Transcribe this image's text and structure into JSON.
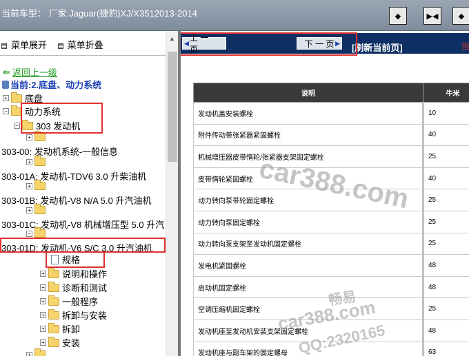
{
  "topbar": {
    "title": "当前车型： 厂家:Jaguar(捷豹)XJ/X3512013-2014"
  },
  "left": {
    "expand_label": "菜单展开",
    "collapse_label": "菜单折叠",
    "back_label": "返回上一级",
    "current_label": "当前:2.底盘、动力系统",
    "tree": {
      "chassis": "底盘",
      "powertrain": "动力系统",
      "engine303": "303 发动机",
      "general": "303-00: 发动机系统-一般信息",
      "tdv6": "303-01A: 发动机-TDV6 3.0 升柴油机",
      "v8na": "303-01B: 发动机-V8 N/A 5.0 升汽油机",
      "v8sc": "303-01C: 发动机-V8 机械增压型 5.0 升汽",
      "v6sc": "303-01D: 发动机-V6 S/C 3.0 升汽油机",
      "spec": "规格",
      "desc": "说明和操作",
      "diag": "诊断和测试",
      "proc": "一般程序",
      "remove_install": "拆卸与安装",
      "remove": "拆卸",
      "install": "安装"
    }
  },
  "right": {
    "prev_label": "上 一 页",
    "next_label": "下 一 页",
    "refresh_label": "[刷新当前页]",
    "red_char": "当",
    "table": {
      "headers": [
        "说明",
        "牛米"
      ],
      "rows": [
        [
          "发动机盖安装螺栓",
          "10"
        ],
        [
          "附件传动带张紧器紧固螺栓",
          "40"
        ],
        [
          "机械增压器皮带惰轮/张紧器支架固定螺栓",
          "25"
        ],
        [
          "皮带惰轮紧固螺栓",
          "40"
        ],
        [
          "动力转向泵带轮固定螺栓",
          "25"
        ],
        [
          "动力转向泵固定螺栓",
          "25"
        ],
        [
          "动力转向泵支架至发动机固定螺栓",
          "25"
        ],
        [
          "发电机紧固螺栓",
          "48"
        ],
        [
          "启动机固定螺栓",
          "48"
        ],
        [
          "空调压缩机固定螺栓",
          "25"
        ],
        [
          "发动机座至发动机安装支架固定螺栓",
          "48"
        ],
        [
          "发动机座与副车架的固定螺母",
          "63"
        ]
      ]
    },
    "watermarks": [
      "car388.com",
      "畅易",
      "car388.com",
      "QQ:2320165"
    ]
  }
}
